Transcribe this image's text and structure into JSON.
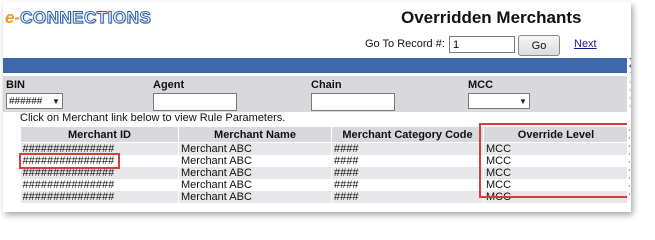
{
  "header": {
    "logo_e": "e-",
    "logo_text": "CONNECTIONS",
    "title": "Overridden Merchants"
  },
  "navigation": {
    "goto_label": "Go To Record #:",
    "goto_value": "1",
    "go_label": "Go",
    "next_label": "Next"
  },
  "filters": {
    "bin_label": "BIN",
    "bin_value": "######",
    "agent_label": "Agent",
    "agent_value": "",
    "chain_label": "Chain",
    "chain_value": "",
    "mcc_label": "MCC",
    "mcc_value": ""
  },
  "instruction": "Click on Merchant link below to view Rule Parameters.",
  "table": {
    "columns": [
      "Merchant ID",
      "Merchant Name",
      "Merchant Category Code",
      "Override Level"
    ],
    "rows": [
      [
        "###############",
        "Merchant ABC",
        "####",
        "MCC"
      ],
      [
        "###############",
        "Merchant ABC",
        "####",
        "MCC"
      ],
      [
        "###############",
        "Merchant ABC",
        "####",
        "MCC"
      ],
      [
        "###############",
        "Merchant ABC",
        "####",
        "MCC"
      ],
      [
        "###############",
        "Merchant ABC",
        "####",
        "MCC"
      ]
    ]
  },
  "colors": {
    "accent_bar": "#3f68a8",
    "header_gray": "#d9d9dd",
    "highlight_red": "#d83c3c",
    "logo_orange": "#f39a1e",
    "logo_blue": "#2f63a9"
  }
}
